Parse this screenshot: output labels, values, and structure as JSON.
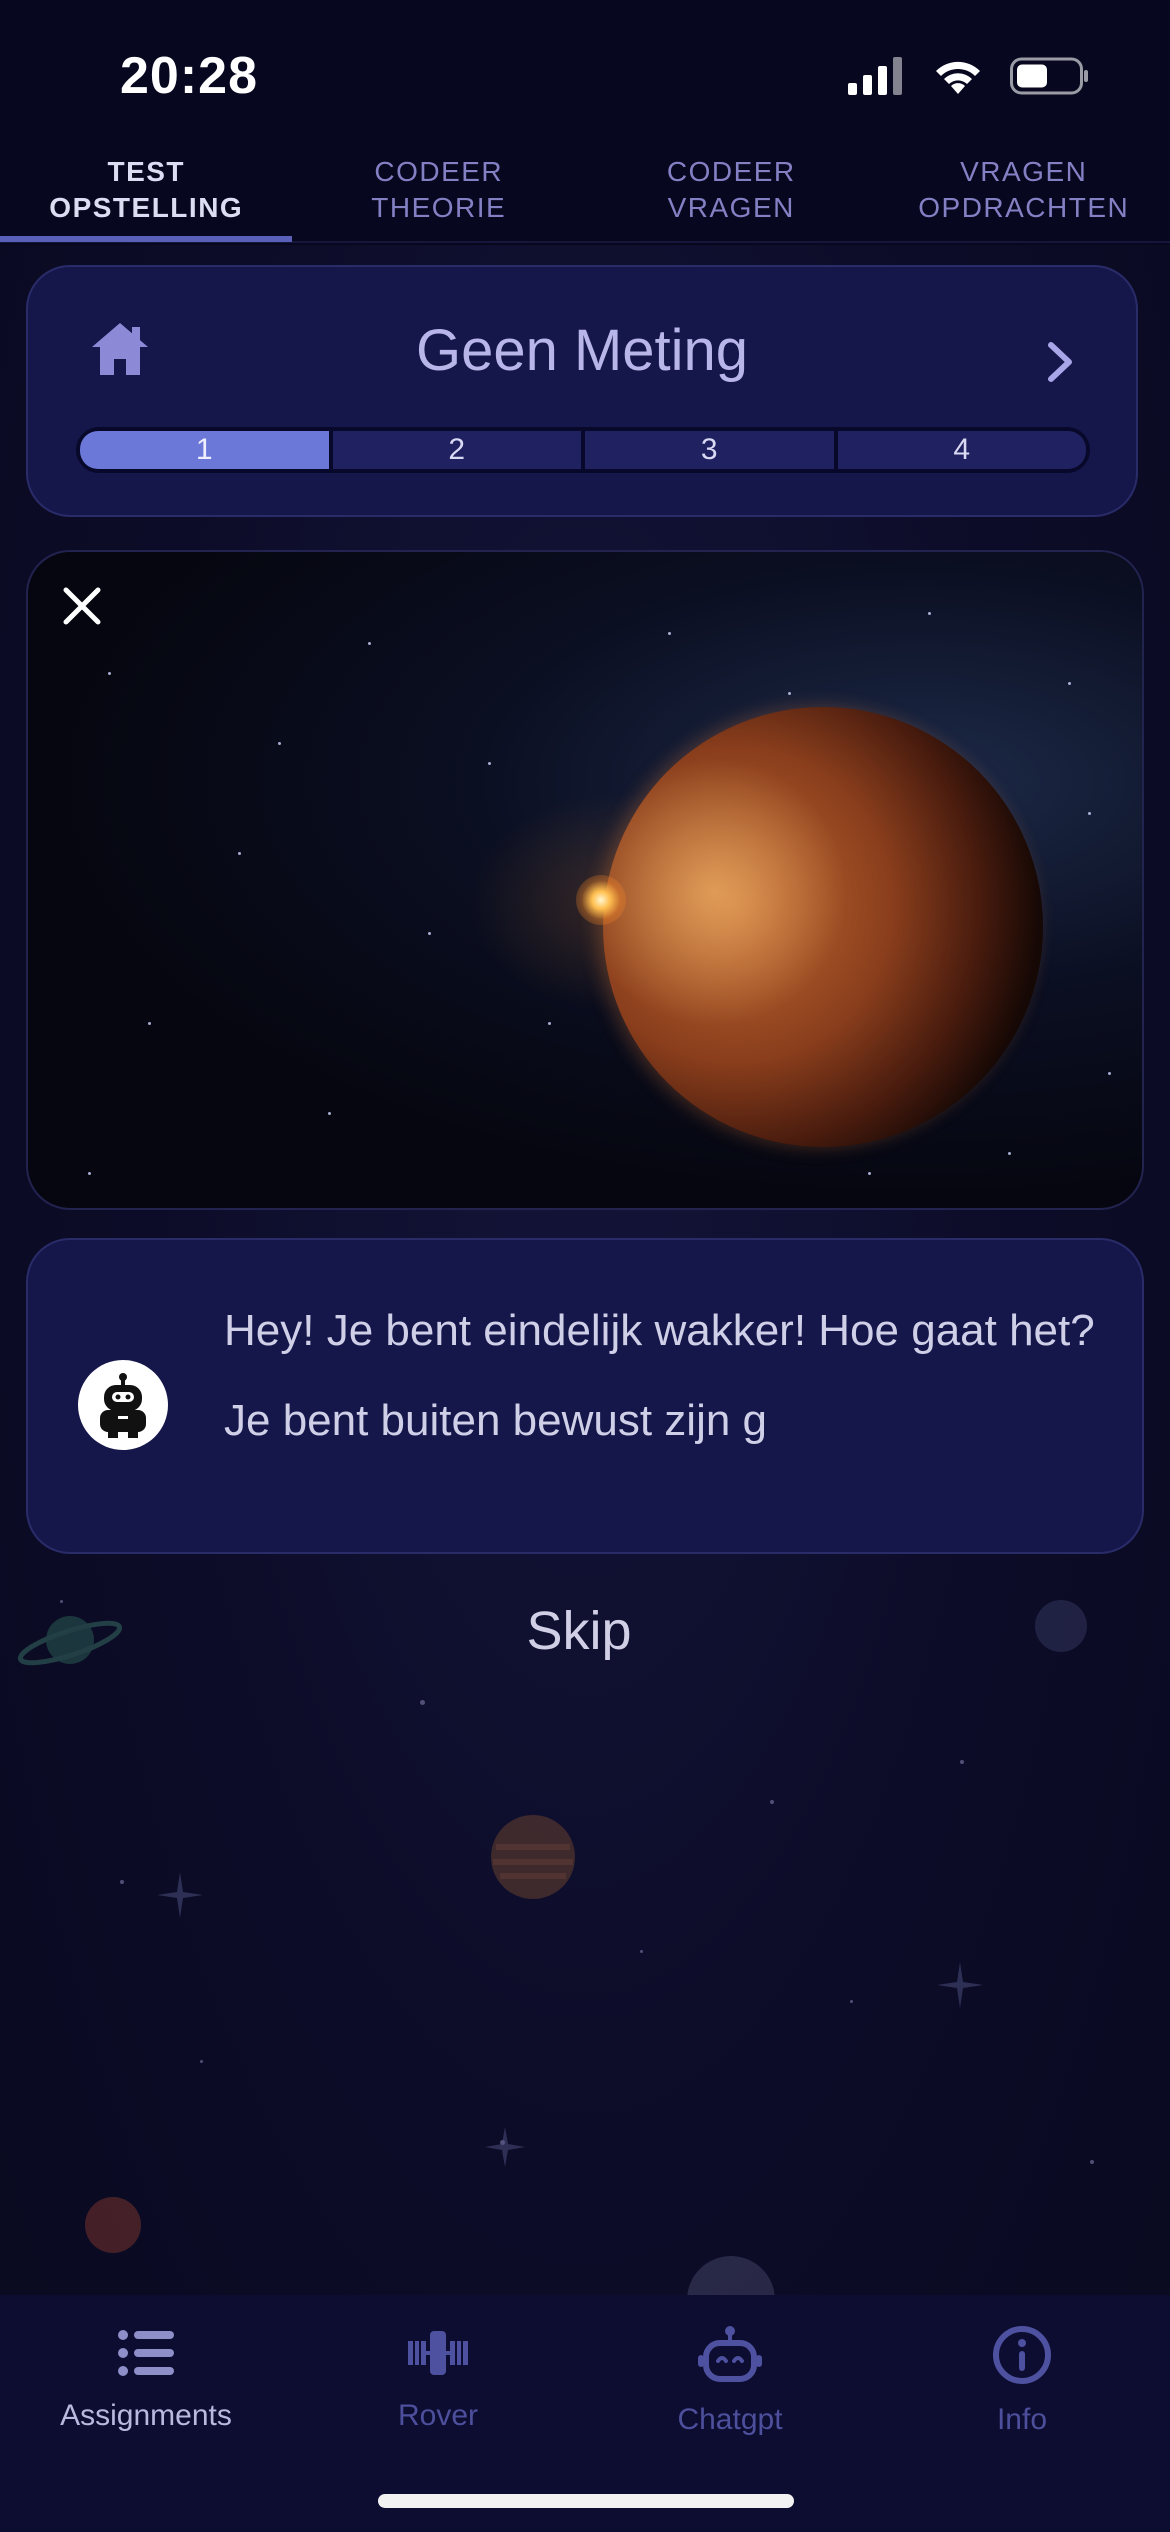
{
  "status_bar": {
    "time": "20:28",
    "icons": [
      "cellular-signal-icon",
      "wifi-icon",
      "battery-icon"
    ]
  },
  "top_tabs": [
    {
      "label": "TEST\nOPSTELLING",
      "active": true
    },
    {
      "label": "CODEER\nTHEORIE",
      "active": false
    },
    {
      "label": "CODEER\nVRAGEN",
      "active": false
    },
    {
      "label": "VRAGEN\nOPDRACHTEN",
      "active": false
    }
  ],
  "measure_card": {
    "title": "Geen Meting",
    "home_icon": "home-icon",
    "next_icon": "chevron-right-icon",
    "steps": [
      "1",
      "2",
      "3",
      "4"
    ],
    "active_step": "1"
  },
  "image_card": {
    "close_icon": "close-icon",
    "image": "planet-in-space-image"
  },
  "message": {
    "avatar_icon": "robot-icon",
    "text": "Hey! Je bent eindelijk wakker! Hoe gaat het? Je bent buiten bewust zijn g"
  },
  "skip_label": "Skip",
  "bottom_nav": [
    {
      "label": "Assignments",
      "icon": "list-icon",
      "active": true
    },
    {
      "label": "Rover",
      "icon": "satellite-icon",
      "active": false
    },
    {
      "label": "Chatgpt",
      "icon": "robot-icon",
      "active": false
    },
    {
      "label": "Info",
      "icon": "info-icon",
      "active": false
    }
  ],
  "colors": {
    "background": "#0b0b24",
    "card": "#15164a",
    "active_step": "#6b78d8",
    "tab_inactive": "#8480c4"
  }
}
